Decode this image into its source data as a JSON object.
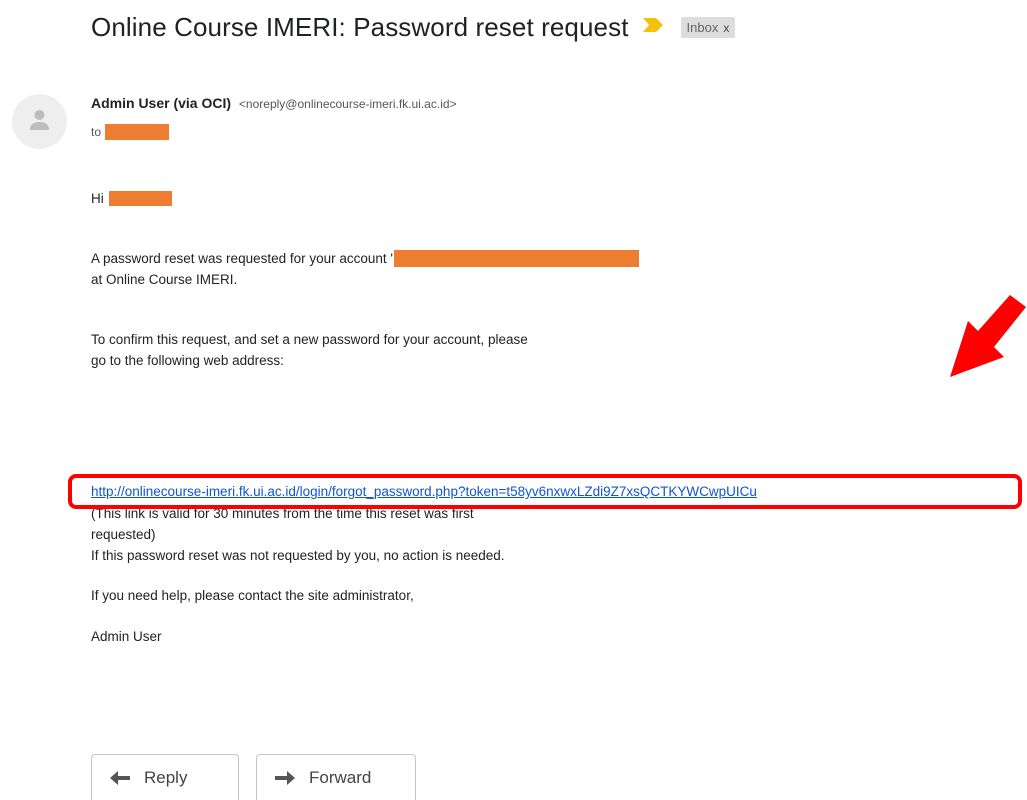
{
  "email": {
    "subject": "Online Course IMERI: Password reset request",
    "label_chip": "Inbox",
    "label_chip_close": "x",
    "sender_name": "Admin User (via OCI)",
    "sender_email": "<noreply@onlinecourse-imeri.fk.ui.ac.id>",
    "to_prefix": "to",
    "greeting": "Hi",
    "para1_line1": "A password reset was requested for your account '",
    "para1_line2": "at Online Course IMERI.",
    "para2_line1": "To confirm this request, and set a new password for your account, please",
    "para2_line2": "go to the following web address:",
    "reset_link": "http://onlinecourse-imeri.fk.ui.ac.id/login/forgot_password.php?token=t58yv6nxwxLZdi9Z7xsQCTKYWCwpUICu",
    "validity_line1": "(This link is valid for 30 minutes from the time this reset was first",
    "validity_line2": "requested)",
    "para3": "If this password reset was not requested by you, no action is needed.",
    "para4": "If you need help, please contact the site administrator,",
    "signature": "Admin User"
  },
  "actions": {
    "reply_label": "Reply",
    "forward_label": "Forward"
  },
  "colors": {
    "redaction": "#ed7d31",
    "highlight": "#ff0000",
    "link": "#1155cc",
    "importance_marker": "#f4c20d"
  }
}
